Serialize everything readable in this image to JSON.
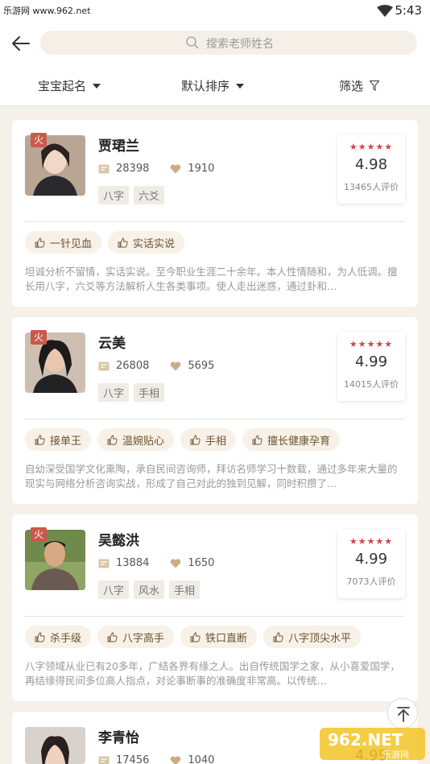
{
  "statusbar": {
    "watermark": "乐游网 www.962.net",
    "time": "5:43"
  },
  "search": {
    "placeholder": "搜索老师姓名"
  },
  "filters": [
    {
      "label": "宝宝起名"
    },
    {
      "label": "默认排序"
    },
    {
      "label": "筛选"
    }
  ],
  "teachers": [
    {
      "element": "火",
      "name": "贾珺兰",
      "consults": "28398",
      "likes": "1910",
      "tags": [
        "八字",
        "六爻"
      ],
      "stars": "★★★★★",
      "score": "4.98",
      "reviews": "13465人评价",
      "praise": [
        "一针见血",
        "实话实说"
      ],
      "desc": "坦诚分析不留情，实话实说。至今职业生涯二十余年。本人性情随和，为人低调。擅长用八字，六爻等方法解析人生各类事项。使人走出迷惑，通过卦和…"
    },
    {
      "element": "火",
      "name": "云美",
      "consults": "26808",
      "likes": "5695",
      "tags": [
        "八字",
        "手相"
      ],
      "stars": "★★★★★",
      "score": "4.99",
      "reviews": "14015人评价",
      "praise": [
        "接单王",
        "温婉贴心",
        "手相",
        "擅长健康孕育"
      ],
      "desc": "自幼深受国学文化熏陶，承自民间咨询师，拜访名师学习十数载，通过多年来大量的现实与网络分析咨询实战，形成了自己对此的独到见解，同时积攒了…"
    },
    {
      "element": "火",
      "name": "吴懿洪",
      "consults": "13884",
      "likes": "1650",
      "tags": [
        "八字",
        "风水",
        "手相"
      ],
      "stars": "★★★★★",
      "score": "4.99",
      "reviews": "7073人评价",
      "praise": [
        "杀手级",
        "八字高手",
        "铁口直断",
        "八字顶尖水平"
      ],
      "desc": "八字领域从业已有20多年，广结各界有缘之人。出自传统国学之家，从小喜爱国学，再结缘得民间多位高人指点，对论事断事的准确度非常高。以传统…"
    },
    {
      "element": "",
      "name": "李青怡",
      "consults": "17456",
      "likes": "1040",
      "tags": [],
      "stars": "",
      "score": "4.99",
      "reviews": "",
      "praise": [],
      "desc": ""
    }
  ],
  "logo": {
    "text": "962.NET",
    "subtitle": "乐游网"
  },
  "colors": {
    "accent": "#c95a4b",
    "star": "#c9474a",
    "pill_bg": "#f7f1e8",
    "page_bg": "#f5f1ea"
  }
}
